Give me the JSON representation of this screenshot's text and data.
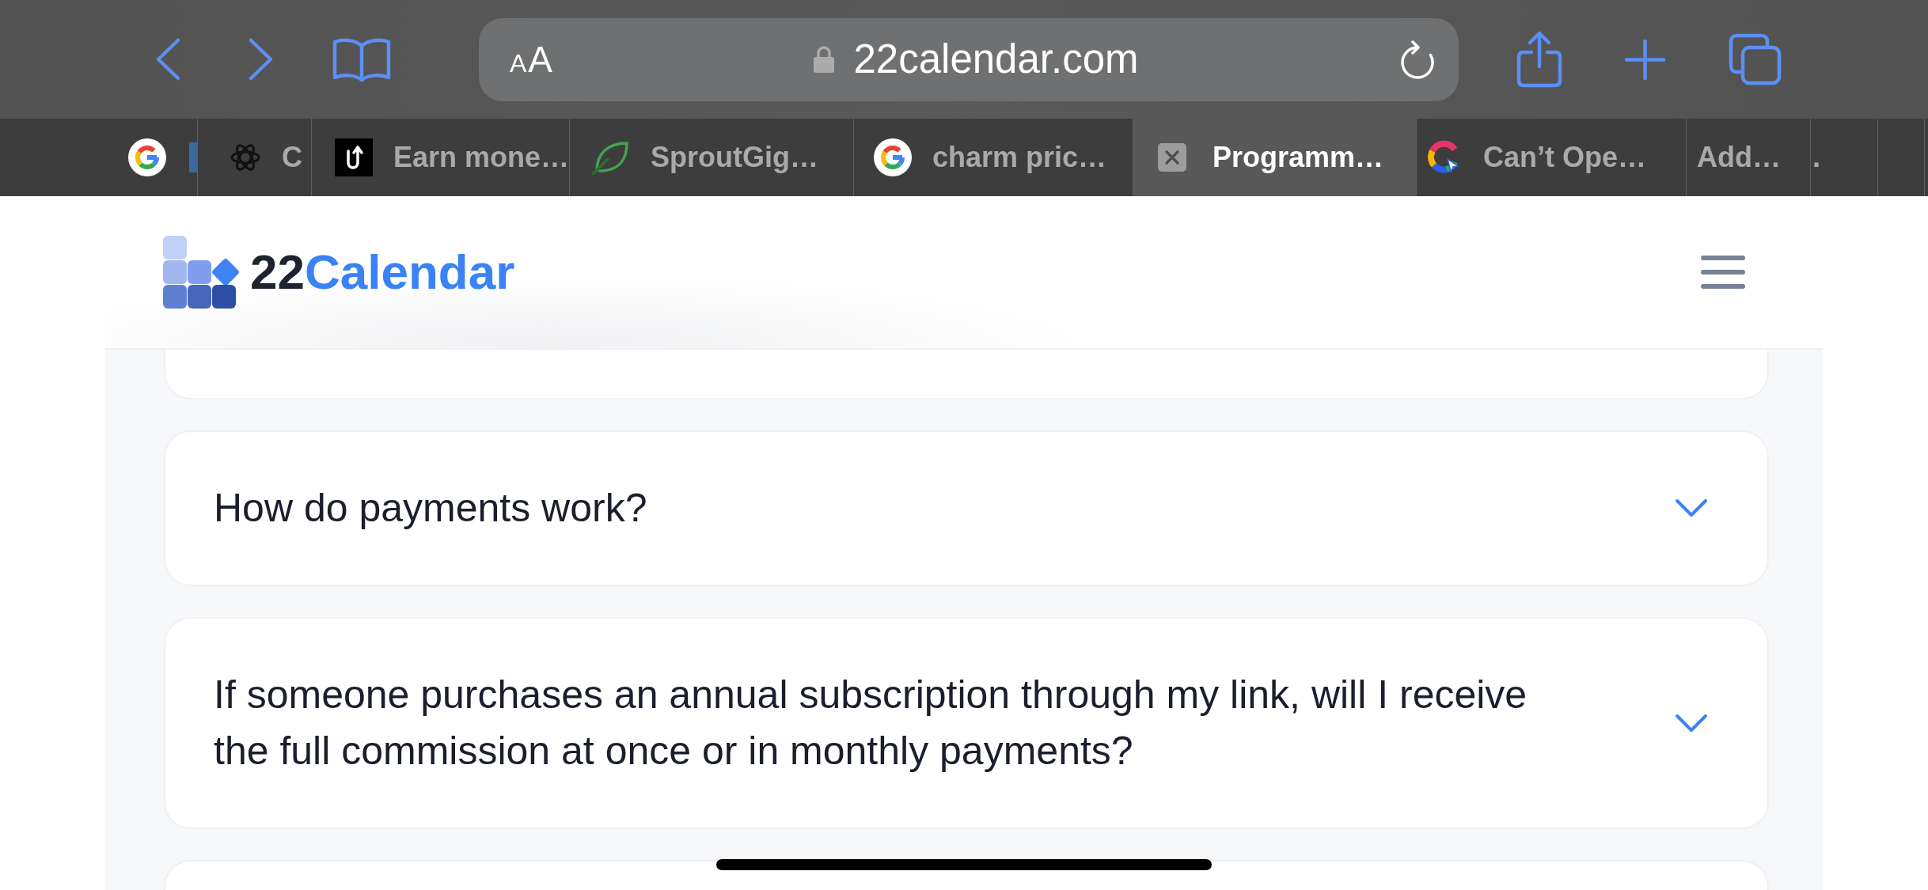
{
  "toolbar": {
    "text_size_button": {
      "small": "A",
      "large": "A"
    },
    "url": "22calendar.com"
  },
  "tabs": [
    {
      "kind": "gmark",
      "edge_mark": true,
      "selected": false
    },
    {
      "kind": "knot",
      "label": "C",
      "selected": false
    },
    {
      "kind": "tile",
      "label": "Earn mone…",
      "selected": false
    },
    {
      "kind": "leaf",
      "label": "SproutGig…",
      "selected": false
    },
    {
      "kind": "gmark",
      "label": "charm pric…",
      "selected": false
    },
    {
      "kind": "close",
      "label": "Programm…",
      "selected": true
    },
    {
      "kind": "swirl",
      "label": "Can’t Ope…",
      "selected": false
    },
    {
      "kind": "plain",
      "label": "Add…",
      "selected": false
    },
    {
      "kind": "plain",
      "label": ".",
      "selected": false
    }
  ],
  "header": {
    "logo": {
      "number": "22",
      "word": "Calendar"
    }
  },
  "faq_items": [
    {
      "kind": "stub"
    },
    {
      "kind": "question",
      "question": "How do payments work?",
      "expanded": false
    },
    {
      "kind": "question",
      "question": "If someone purchases an annual subscription through my link, will I receive the full commission at once or in monthly payments?",
      "expanded": false
    },
    {
      "kind": "stub"
    }
  ]
}
